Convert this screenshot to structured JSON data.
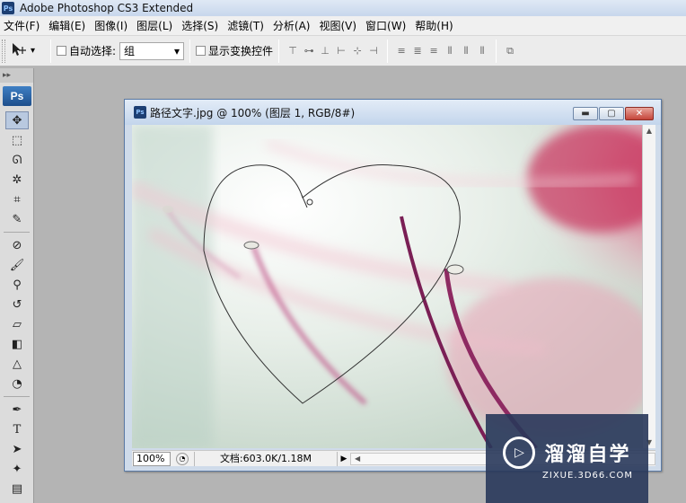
{
  "app": {
    "title": "Adobe Photoshop CS3 Extended",
    "logo": "Ps"
  },
  "menu": [
    "文件(F)",
    "编辑(E)",
    "图像(I)",
    "图层(L)",
    "选择(S)",
    "滤镜(T)",
    "分析(A)",
    "视图(V)",
    "窗口(W)",
    "帮助(H)"
  ],
  "options": {
    "auto_select_label": "自动选择:",
    "auto_select_value": "组",
    "show_transform_label": "显示变换控件",
    "align_icons": [
      "align-top-icon",
      "align-vcenter-icon",
      "align-bottom-icon",
      "align-left-icon",
      "align-hcenter-icon",
      "align-right-icon",
      "distribute-top-icon",
      "distribute-vcenter-icon",
      "distribute-bottom-icon",
      "distribute-left-icon",
      "distribute-hcenter-icon",
      "distribute-right-icon",
      "auto-align-icon"
    ]
  },
  "toolbox": {
    "badge": "Ps",
    "tools": [
      "move-tool-icon",
      "marquee-tool-icon",
      "lasso-tool-icon",
      "magic-wand-icon",
      "crop-tool-icon",
      "slice-tool-icon",
      "healing-brush-icon",
      "brush-tool-icon",
      "clone-stamp-icon",
      "history-brush-icon",
      "eraser-tool-icon",
      "paint-bucket-icon",
      "blur-tool-icon",
      "dodge-tool-icon",
      "pen-tool-icon",
      "type-tool-icon",
      "path-selection-icon",
      "custom-shape-icon",
      "notes-tool-icon"
    ]
  },
  "document": {
    "title": "路径文字.jpg @ 100% (图层 1, RGB/8#)",
    "zoom": "100%",
    "doc_info": "文档:603.0K/1.18M"
  },
  "watermark": {
    "name": "溜溜自学",
    "url": "ZIXUE.3D66.COM"
  },
  "colors": {
    "titlebar": "#c7d7ec",
    "canvas_bg": "#b4b4b4",
    "flower_pink": "#d2466e",
    "stem_purple": "#7a1f55",
    "watermark_bg": "#28375a"
  }
}
